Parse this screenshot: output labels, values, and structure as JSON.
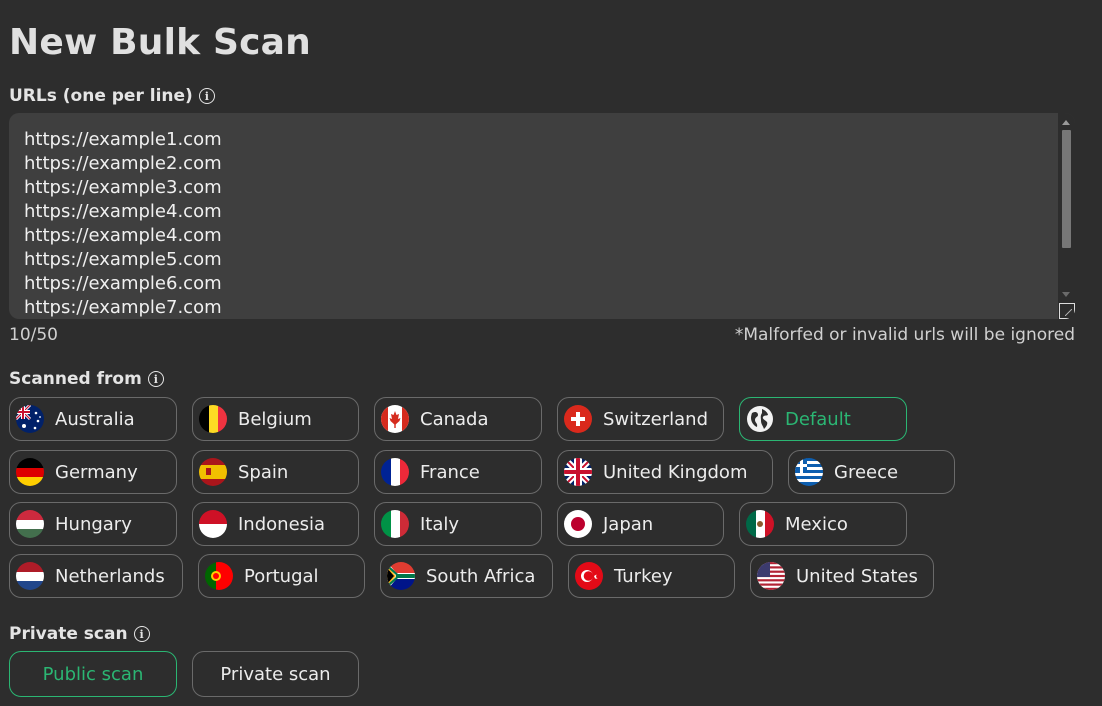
{
  "title": "New Bulk Scan",
  "urls_field": {
    "label": "URLs (one per line)",
    "lines": [
      "https://example1.com",
      "https://example2.com",
      "https://example3.com",
      "https://example4.com",
      "https://example4.com",
      "https://example5.com",
      "https://example6.com",
      "https://example7.com"
    ],
    "counter": "10/50",
    "note": "*Malforfed or invalid urls will be ignored"
  },
  "scanned_from": {
    "label": "Scanned from",
    "selected": "Default",
    "countries": [
      {
        "label": "Australia",
        "icon": "australia-flag-icon"
      },
      {
        "label": "Belgium",
        "icon": "belgium-flag-icon"
      },
      {
        "label": "Canada",
        "icon": "canada-flag-icon"
      },
      {
        "label": "Switzerland",
        "icon": "switzerland-flag-icon"
      },
      {
        "label": "Default",
        "icon": "globe-icon"
      },
      {
        "label": "Germany",
        "icon": "germany-flag-icon"
      },
      {
        "label": "Spain",
        "icon": "spain-flag-icon"
      },
      {
        "label": "France",
        "icon": "france-flag-icon"
      },
      {
        "label": "United Kingdom",
        "icon": "united-kingdom-flag-icon"
      },
      {
        "label": "Greece",
        "icon": "greece-flag-icon"
      },
      {
        "label": "Hungary",
        "icon": "hungary-flag-icon"
      },
      {
        "label": "Indonesia",
        "icon": "indonesia-flag-icon"
      },
      {
        "label": "Italy",
        "icon": "italy-flag-icon"
      },
      {
        "label": "Japan",
        "icon": "japan-flag-icon"
      },
      {
        "label": "Mexico",
        "icon": "mexico-flag-icon"
      },
      {
        "label": "Netherlands",
        "icon": "netherlands-flag-icon"
      },
      {
        "label": "Portugal",
        "icon": "portugal-flag-icon"
      },
      {
        "label": "South Africa",
        "icon": "south-africa-flag-icon"
      },
      {
        "label": "Turkey",
        "icon": "turkey-flag-icon"
      },
      {
        "label": "United States",
        "icon": "united-states-flag-icon"
      }
    ]
  },
  "private_scan": {
    "label": "Private scan",
    "selected": "Public scan",
    "options": [
      {
        "label": "Public scan"
      },
      {
        "label": "Private scan"
      }
    ]
  },
  "colors": {
    "background": "#2d2d2d",
    "accent": "#2bb673",
    "border": "#6a6a6a",
    "textarea_bg": "#3f3f3f"
  }
}
